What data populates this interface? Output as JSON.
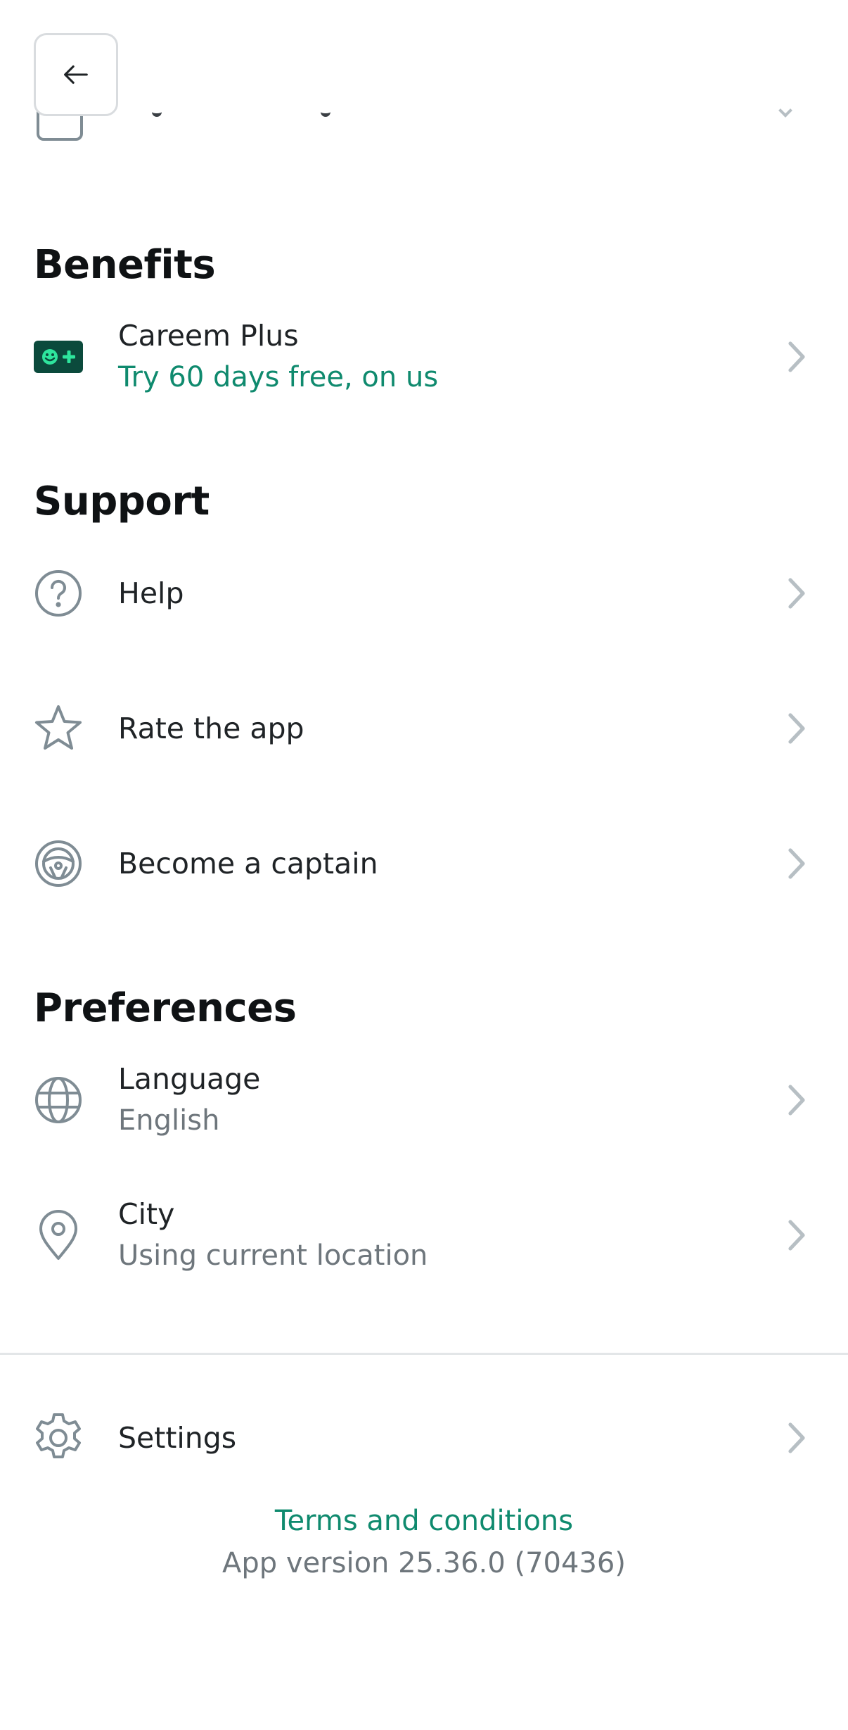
{
  "sections": {
    "benefits": "Benefits",
    "support": "Support",
    "preferences": "Preferences"
  },
  "rows": {
    "careem_plus": {
      "label": "Careem Plus",
      "sub": "Try 60 days free, on us"
    },
    "help": {
      "label": "Help"
    },
    "rate": {
      "label": "Rate the app"
    },
    "captain": {
      "label": "Become a captain"
    },
    "language": {
      "label": "Language",
      "sub": "English"
    },
    "city": {
      "label": "City",
      "sub": "Using current location"
    },
    "settings": {
      "label": "Settings"
    }
  },
  "footer": {
    "terms": "Terms and conditions",
    "version": "App version 25.36.0 (70436)"
  },
  "colors": {
    "accent": "#0f8a6e",
    "icon_gray": "#7f8c94",
    "chevron": "#b7bfc4",
    "plus_badge_bg": "#0b4a3c",
    "plus_badge_fg": "#2ee59d"
  },
  "icons": {
    "back": "arrow-left-icon",
    "careem_plus": "careem-plus-badge-icon",
    "help": "question-circle-icon",
    "rate": "star-icon",
    "captain": "steering-wheel-icon",
    "language": "globe-icon",
    "city": "location-pin-icon",
    "settings": "gear-icon",
    "chevron": "chevron-right-icon"
  }
}
